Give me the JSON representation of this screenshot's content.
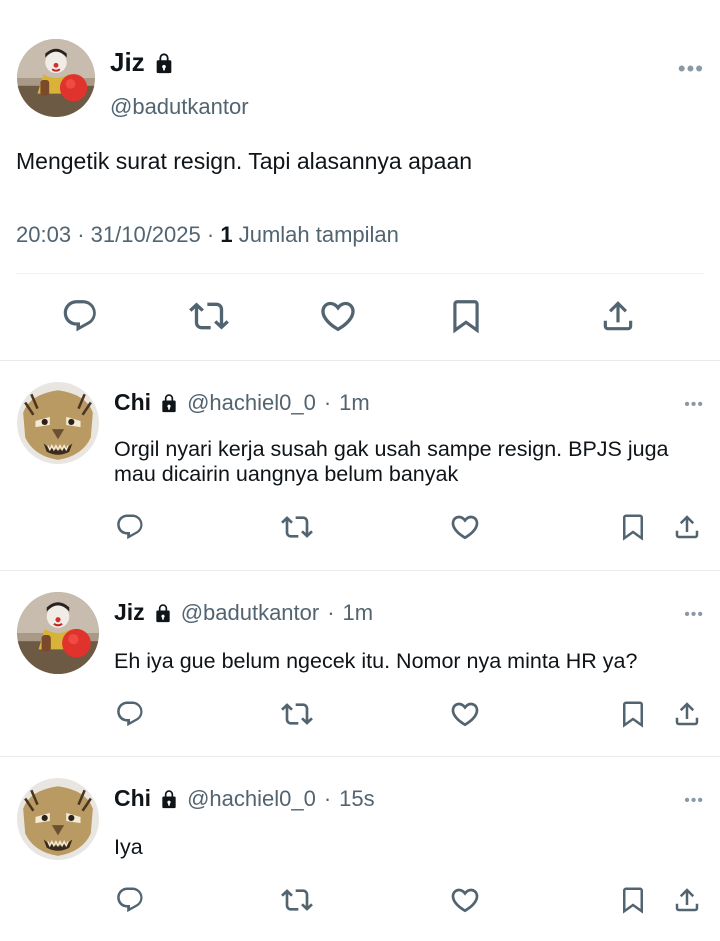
{
  "main_post": {
    "name": "Jiz",
    "handle": "@badutkantor",
    "text": "Mengetik surat resign. Tapi alasannya apaan",
    "time": "20:03",
    "date": "31/10/2025",
    "views_count": "1",
    "views_label": "Jumlah tampilan",
    "more": "•••"
  },
  "replies": [
    {
      "name": "Chi",
      "handle": "@hachiel0_0",
      "age": "1m",
      "text": "Orgil nyari kerja susah gak usah sampe resign. BPJS juga mau dicairin uangnya belum banyak",
      "avatar": "tiger-mask",
      "more": "•••"
    },
    {
      "name": "Jiz",
      "handle": "@badutkantor",
      "age": "1m",
      "text": "Eh iya gue belum ngecek itu. Nomor nya minta HR ya?",
      "avatar": "clown",
      "more": "•••"
    },
    {
      "name": "Chi",
      "handle": "@hachiel0_0",
      "age": "15s",
      "text": "Iya",
      "avatar": "tiger-mask",
      "more": "•••"
    }
  ],
  "separator": "·",
  "colors": {
    "text": "#0f1419",
    "secondary": "#536471",
    "divider": "#eff3f4",
    "icon": "#536471"
  }
}
